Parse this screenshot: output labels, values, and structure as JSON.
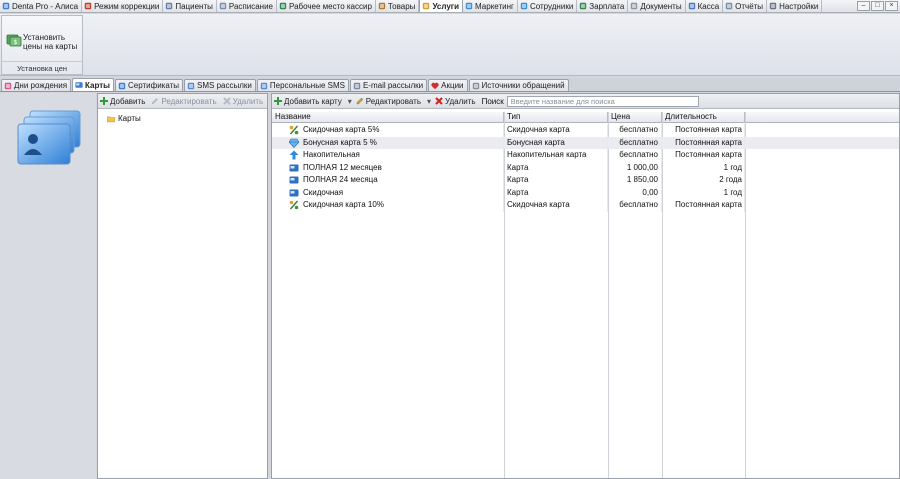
{
  "menu": {
    "items": [
      {
        "label": "Denta Pro - Алиса",
        "icon": "app-logo-icon",
        "color": "#3c7fd0"
      },
      {
        "label": "Режим коррекции",
        "icon": "edit-mode-icon",
        "color": "#c0392b"
      },
      {
        "label": "Пациенты",
        "icon": "patients-icon",
        "color": "#6a7fa8"
      },
      {
        "label": "Расписание",
        "icon": "calendar-icon",
        "color": "#7b8ea8"
      },
      {
        "label": "Рабочее место кассир",
        "icon": "cashier-icon",
        "color": "#2d8a4e"
      },
      {
        "label": "Товары",
        "icon": "goods-icon",
        "color": "#b07a2e"
      },
      {
        "label": "Услуги",
        "icon": "services-icon",
        "color": "#d8a030",
        "active": true
      },
      {
        "label": "Маркетинг",
        "icon": "marketing-icon",
        "color": "#3a8fd8"
      },
      {
        "label": "Сотрудники",
        "icon": "staff-icon",
        "color": "#3a8fd8"
      },
      {
        "label": "Зарплата",
        "icon": "salary-icon",
        "color": "#2d8a4e"
      },
      {
        "label": "Документы",
        "icon": "documents-icon",
        "color": "#8d949f"
      },
      {
        "label": "Касса",
        "icon": "cash-register-icon",
        "color": "#4a78c0"
      },
      {
        "label": "Отчёты",
        "icon": "reports-icon",
        "color": "#7b8ea8"
      },
      {
        "label": "Настройки",
        "icon": "settings-icon",
        "color": "#6a7384"
      }
    ],
    "window_buttons": [
      "–",
      "□",
      "×"
    ]
  },
  "ribbon": {
    "button_label_line1": "Установить",
    "button_label_line2": "цены на карты",
    "group_label": "Установка цен"
  },
  "tabs": [
    {
      "label": "Дни рождения",
      "icon": "birthday-icon",
      "color": "#d05a8c"
    },
    {
      "label": "Карты",
      "icon": "card-icon",
      "color": "#3a7fd0",
      "active": true
    },
    {
      "label": "Сертификаты",
      "icon": "certificate-icon",
      "color": "#3a7fd0"
    },
    {
      "label": "SMS рассылки",
      "icon": "sms-icon",
      "color": "#5a8ad0"
    },
    {
      "label": "Персональные SMS",
      "icon": "personal-sms-icon",
      "color": "#5a8ad0"
    },
    {
      "label": "E-mail рассылки",
      "icon": "email-icon",
      "color": "#7a8aa0"
    },
    {
      "label": "Акции",
      "icon": "heart-icon",
      "color": "#d02a2a"
    },
    {
      "label": "Источники обращений",
      "icon": "sources-icon",
      "color": "#8a8f98"
    }
  ],
  "tree_toolbar": {
    "add": "Добавить",
    "edit": "Редактировать",
    "delete": "Удалить"
  },
  "tree": {
    "items": [
      {
        "label": "Карты",
        "icon": "folder-icon"
      }
    ]
  },
  "grid_toolbar": {
    "add": "Добавить карту",
    "edit": "Редактировать",
    "delete": "Удалить",
    "search_label": "Поиск",
    "search_placeholder": "Введите название для поиска",
    "search_value": ""
  },
  "grid": {
    "columns": [
      "Название",
      "Тип",
      "Цена",
      "Длительность"
    ],
    "rows": [
      {
        "name": "Скидочная карта 5%",
        "type": "Скидочная карта",
        "price": "бесплатно",
        "duration": "Постоянная карта",
        "icon": "percent-icon",
        "selected": false
      },
      {
        "name": "Бонусная карта 5 %",
        "type": "Бонусная карта",
        "price": "бесплатно",
        "duration": "Постоянная карта",
        "icon": "diamond-icon",
        "selected": true
      },
      {
        "name": "Накопительная",
        "type": "Накопительная карта",
        "price": "бесплатно",
        "duration": "Постоянная карта",
        "icon": "arrow-up-icon",
        "selected": false
      },
      {
        "name": "ПОЛНАЯ 12 месяцев",
        "type": "Карта",
        "price": "1 000,00",
        "duration": "1 год",
        "icon": "card-icon",
        "selected": false
      },
      {
        "name": "ПОЛНАЯ 24 месяца",
        "type": "Карта",
        "price": "1 850,00",
        "duration": "2 года",
        "icon": "card-icon",
        "selected": false
      },
      {
        "name": "Скидочная",
        "type": "Карта",
        "price": "0,00",
        "duration": "1 год",
        "icon": "card-icon",
        "selected": false
      },
      {
        "name": "Скидочная карта 10%",
        "type": "Скидочная карта",
        "price": "бесплатно",
        "duration": "Постоянная карта",
        "icon": "percent-icon",
        "selected": false
      }
    ]
  },
  "colors": {
    "accent": "#3a7fd0",
    "selection": "#ebecef",
    "add_green": "#2e9a3a",
    "delete_red": "#d02020"
  }
}
